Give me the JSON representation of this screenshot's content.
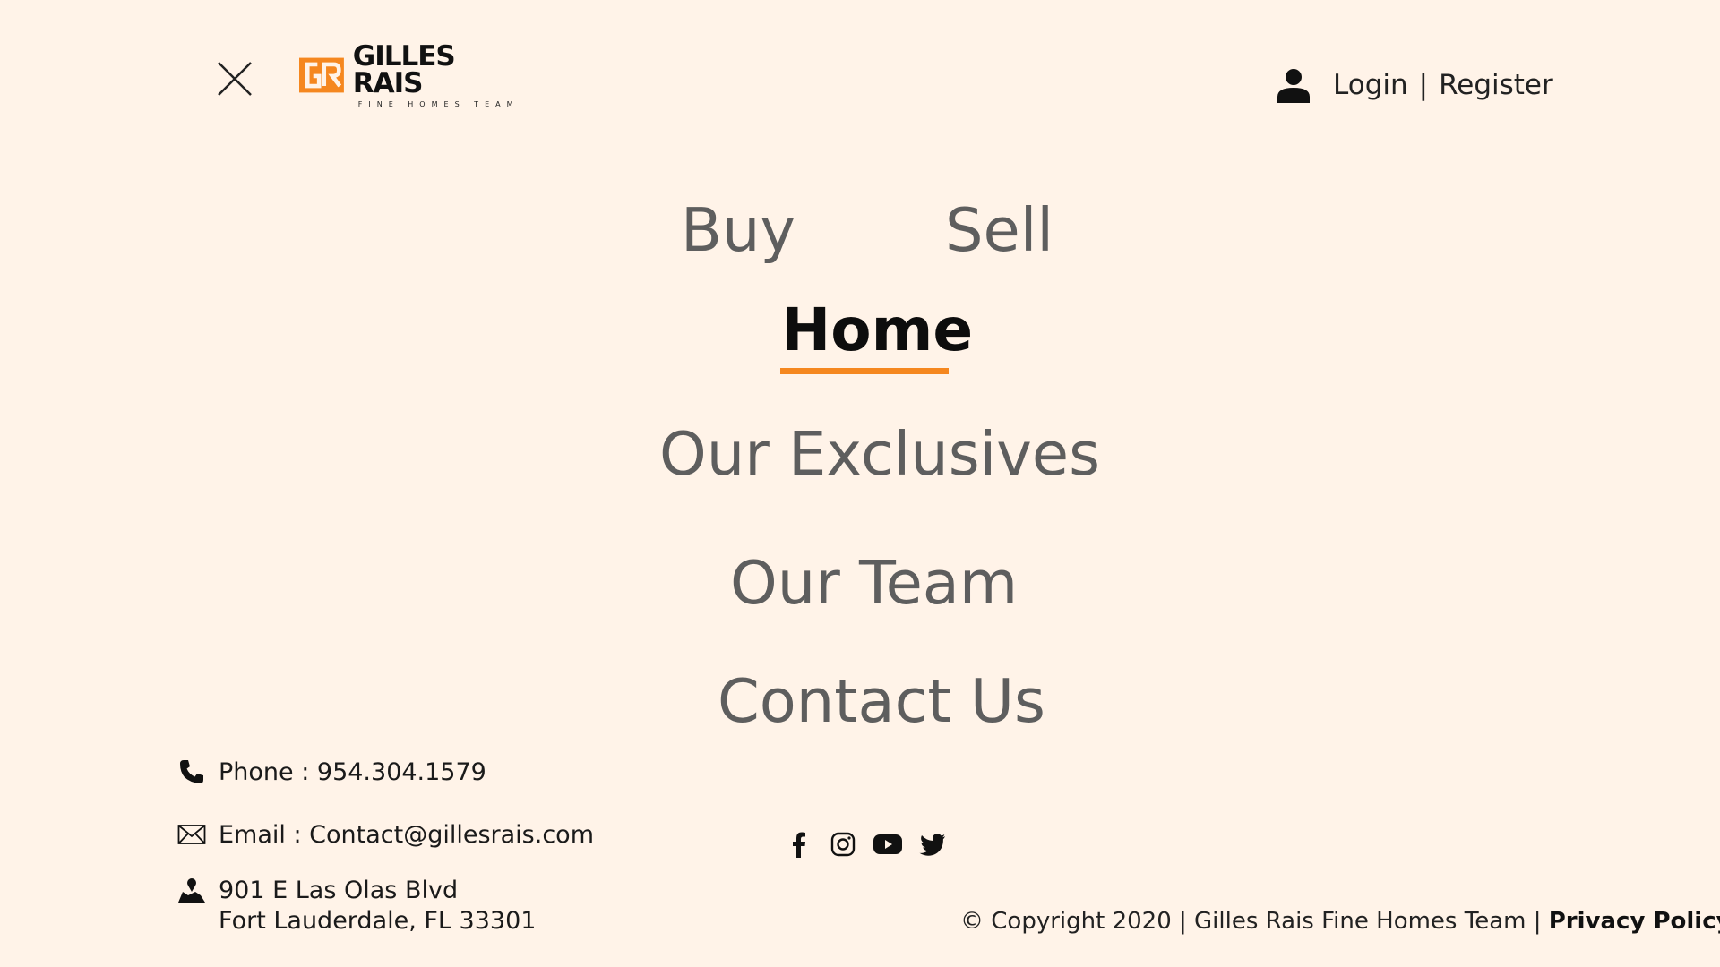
{
  "header": {
    "logo_name": "GILLES RAIS",
    "logo_tagline": "FINE HOMES TEAM",
    "login_label": "Login",
    "separator": "|",
    "register_label": "Register"
  },
  "nav": {
    "buy": "Buy",
    "sell": "Sell",
    "home": "Home",
    "exclusives": "Our Exclusives",
    "team": "Our Team",
    "contact": "Contact Us"
  },
  "contact_info": {
    "phone": "Phone : 954.304.1579",
    "email": "Email : Contact@gillesrais.com",
    "address_line1": "901 E Las Olas Blvd",
    "address_line2": "Fort Lauderdale, FL 33301"
  },
  "social": [
    "facebook-icon",
    "instagram-icon",
    "youtube-icon",
    "twitter-icon"
  ],
  "footer": {
    "copyright": "© Copyright 2020 | Gilles Rais Fine Homes Team | ",
    "privacy_label": "Privacy Policy"
  },
  "colors": {
    "background": "#fff3e8",
    "accent": "#f5871f",
    "nav_text": "#5e5e5e",
    "active_text": "#0d0d0d"
  }
}
